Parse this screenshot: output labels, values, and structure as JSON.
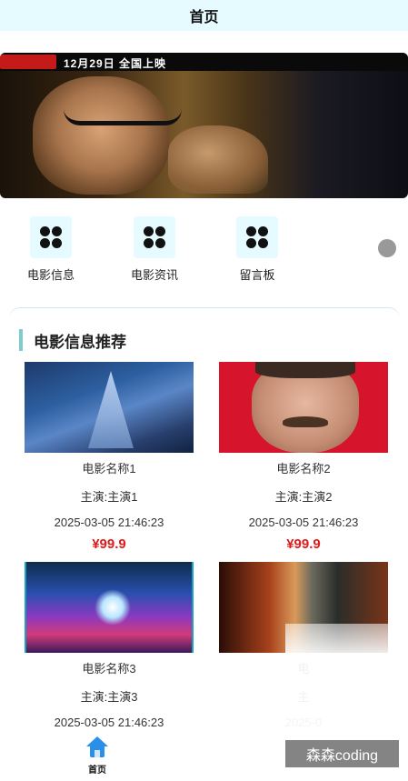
{
  "header": {
    "title": "首页"
  },
  "banner": {
    "release_text": "12月29日 全国上映",
    "dots": [
      false,
      true,
      false
    ]
  },
  "menu": {
    "items": [
      {
        "label": "电影信息",
        "icon": "clover-icon"
      },
      {
        "label": "电影资讯",
        "icon": "clover-icon"
      },
      {
        "label": "留言板",
        "icon": "clover-icon"
      }
    ]
  },
  "recommend": {
    "title": "电影信息推荐",
    "cards": [
      {
        "name": "电影名称1",
        "actor": "主演:主演1",
        "date": "2025-03-05 21:46:23",
        "price": "¥99.9"
      },
      {
        "name": "电影名称2",
        "actor": "主演:主演2",
        "date": "2025-03-05 21:46:23",
        "price": "¥99.9"
      },
      {
        "name": "电影名称3",
        "actor": "主演:主演3",
        "date": "2025-03-05 21:46:23",
        "price": ""
      },
      {
        "name": "电",
        "actor": "主",
        "date": "2025-0",
        "price": ""
      }
    ]
  },
  "tabbar": {
    "home_label": "首页",
    "home_icon": "home-icon",
    "accent": "#2a8fe8"
  },
  "watermark": {
    "text": "森森coding"
  },
  "colors": {
    "header_bg": "#e6fbff",
    "price": "#e11b1b",
    "section_bar": "#7fcbd0"
  }
}
